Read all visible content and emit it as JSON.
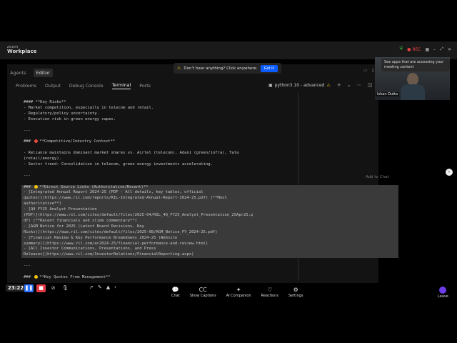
{
  "app": {
    "brand_small": "zoom",
    "brand_name": "Workplace"
  },
  "top_status": {
    "rec": "REC"
  },
  "notice": {
    "warn_icon": "⚠",
    "text": "Don't hear anything? Click anywhere.",
    "button": "Got It"
  },
  "agent_tabs": [
    "Agents",
    "Editor"
  ],
  "panel_tabs": [
    "Problems",
    "Output",
    "Debug Console",
    "Terminal",
    "Ports"
  ],
  "kernel": {
    "label": "python3.10 - advanced"
  },
  "add_to_chat": "Add to Chat",
  "terminal_lines": [
    {
      "text": "#### **Key Risks**",
      "hl": false
    },
    {
      "text": "- Market competition, especially in telecom and retail.",
      "hl": false
    },
    {
      "text": "- Regulatory/policy uncertainty.",
      "hl": false
    },
    {
      "text": "- Execution risk in green energy capex.",
      "hl": false
    },
    {
      "text": "",
      "hl": false
    },
    {
      "text": "---",
      "hl": false
    },
    {
      "text": "",
      "hl": false
    },
    {
      "text": "### [red] **Competitive/Industry Context**",
      "hl": false,
      "dot": "#e74c3c"
    },
    {
      "text": "",
      "hl": false
    },
    {
      "text": "- Reliance maintains dominant market shares vs. Airtel (telecom), Adani (green/infra), Tata",
      "hl": false
    },
    {
      "text": "(retail/energy).",
      "hl": false
    },
    {
      "text": "- Sector trend: Consolidation in telecom, green energy investments accelerating.",
      "hl": false
    },
    {
      "text": "",
      "hl": false
    },
    {
      "text": "---",
      "hl": false
    },
    {
      "text": "",
      "hl": false
    },
    {
      "text": "### [yellow] **Direct Source Links (Authoritative/Recent)**",
      "hl": true,
      "dot": "#f1c40f"
    },
    {
      "text": "- [Integrated Annual Report 2024-25 (PDF - All details, key tables, official",
      "hl": true
    },
    {
      "text": "quotes)](https://www.ril.com/reports/RIL-Integrated-Annual-Report-2024-25.pdf) (**Most",
      "hl": true
    },
    {
      "text": "authoritative**)",
      "hl": true
    },
    {
      "text": "- [Q4 FY25 Analyst Presentation",
      "hl": true
    },
    {
      "text": "(PDF)](https://www.ril.com/sites/default/files/2025-04/RIL_4Q_FY25_Analyst_Presentation_25Apr25.p",
      "hl": true
    },
    {
      "text": "df) (**Recent financials and slide commentary**)",
      "hl": true
    },
    {
      "text": "- [AGM Notice for 2025 (Latest Board Decisions, Key",
      "hl": true
    },
    {
      "text": "Risks)](https://www.ril.com/sites/default/files/2025-08/AGM_Notice_FY_2024-25.pdf)",
      "hl": true
    },
    {
      "text": "- [Financial Review & Key Performance Breakdowns 2024-25 (Website",
      "hl": true
    },
    {
      "text": "summary)](https://www.ril.com/ar2024-25/financial-performance-and-review.html)",
      "hl": true
    },
    {
      "text": "- [All Investor Communications, Presentations, and Press",
      "hl": true
    },
    {
      "text": "Releases](https://www.ril.com/InvestorRelations/FinancialReporting.aspx)",
      "hl": true
    },
    {
      "text": "",
      "hl": false
    },
    {
      "text": "---",
      "hl": false
    },
    {
      "text": "",
      "hl": false
    },
    {
      "text": "### [yellow] **Key Quotes From Management**",
      "hl": false,
      "dot": "#f1c40f"
    }
  ],
  "video": {
    "tooltip": "See apps that are accessing your meeting content",
    "name": "Ishan Dutta"
  },
  "toolbar": {
    "timer": "23:22",
    "buttons": [
      {
        "icon": "chat-icon",
        "glyph": "💬",
        "label": "Chat"
      },
      {
        "icon": "captions-icon",
        "glyph": "CC",
        "label": "Show Captions"
      },
      {
        "icon": "ai-companion-icon",
        "glyph": "✦",
        "label": "AI Companion"
      },
      {
        "icon": "reactions-icon",
        "glyph": "♡",
        "label": "Reactions"
      },
      {
        "icon": "settings-icon",
        "glyph": "⚙",
        "label": "Settings"
      }
    ],
    "leave": "Leave"
  }
}
